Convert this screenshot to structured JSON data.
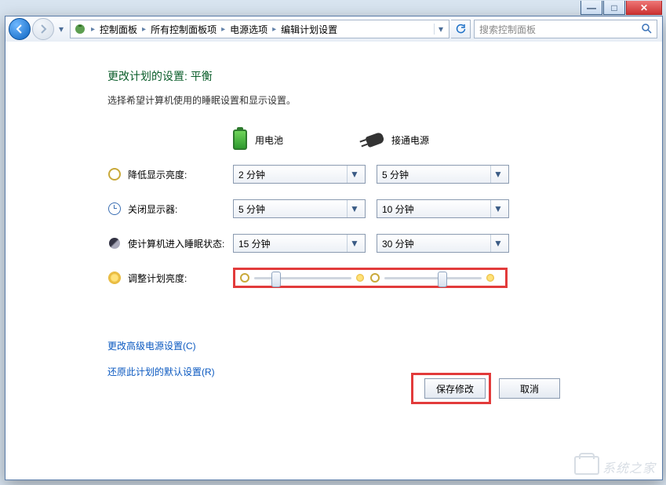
{
  "titlebar": {
    "min": "—",
    "max": "□",
    "close": "✕"
  },
  "nav": {
    "crumbs": [
      "控制面板",
      "所有控制面板项",
      "电源选项",
      "编辑计划设置"
    ],
    "search_placeholder": "搜索控制面板"
  },
  "page": {
    "title": "更改计划的设置: 平衡",
    "subtitle": "选择希望计算机使用的睡眠设置和显示设置。"
  },
  "columns": {
    "battery": "用电池",
    "plugged": "接通电源"
  },
  "rows": {
    "dim": {
      "label": "降低显示亮度:",
      "battery": "2 分钟",
      "plugged": "5 分钟"
    },
    "off": {
      "label": "关闭显示器:",
      "battery": "5 分钟",
      "plugged": "10 分钟"
    },
    "sleep": {
      "label": "使计算机进入睡眠状态:",
      "battery": "15 分钟",
      "plugged": "30 分钟"
    },
    "brightness": {
      "label": "调整计划亮度:",
      "battery_pct": 18,
      "plugged_pct": 55
    }
  },
  "links": {
    "advanced": "更改高级电源设置(C)",
    "restore": "还原此计划的默认设置(R)"
  },
  "buttons": {
    "save": "保存修改",
    "cancel": "取消"
  },
  "watermark": "系统之家"
}
